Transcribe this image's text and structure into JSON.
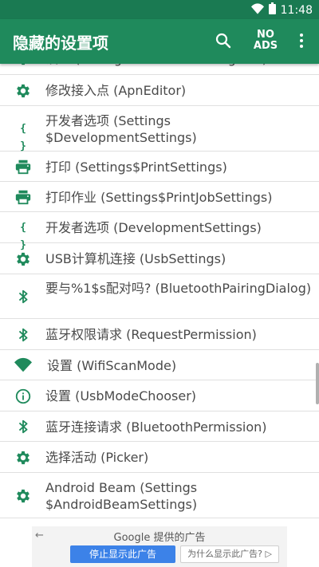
{
  "status_bar": {
    "time": "11:48"
  },
  "app_bar": {
    "title": "隐藏的设置项",
    "no_ads_line1": "NO",
    "no_ads_line2": "ADS"
  },
  "items": [
    {
      "icon": "gear-icon",
      "label": "设置 (StorageWizardMoveProgress)"
    },
    {
      "icon": "gear-icon",
      "label": "修改接入点 (ApnEditor)"
    },
    {
      "icon": "braces-icon",
      "label": "开发者选项 (Settings $DevelopmentSettings)"
    },
    {
      "icon": "printer-icon",
      "label": "打印 (Settings$PrintSettings)"
    },
    {
      "icon": "printer-icon",
      "label": "打印作业 (Settings$PrintJobSettings)"
    },
    {
      "icon": "braces-icon",
      "label": "开发者选项 (DevelopmentSettings)"
    },
    {
      "icon": "gear-icon",
      "label": "USB计算机连接 (UsbSettings)"
    },
    {
      "icon": "bluetooth-icon",
      "label": "要与%1$s配对吗? (BluetoothPairingDialog)"
    },
    {
      "icon": "bluetooth-icon",
      "label": "蓝牙权限请求 (RequestPermission)"
    },
    {
      "icon": "wifi-icon",
      "label": "设置 (WifiScanMode)"
    },
    {
      "icon": "info-icon",
      "label": "设置 (UsbModeChooser)"
    },
    {
      "icon": "bluetooth-icon",
      "label": "蓝牙连接请求 (BluetoothPermission)"
    },
    {
      "icon": "gear-icon",
      "label": "选择活动 (Picker)"
    },
    {
      "icon": "gear-icon",
      "label": "Android Beam (Settings $AndroidBeamSettings)"
    }
  ],
  "ad": {
    "title": "Google 提供的广告",
    "stop_label": "停止显示此广告",
    "why_label": "为什么显示此广告?"
  },
  "colors": {
    "accent": "#1f8a5c",
    "status_bar": "#1a7a52"
  }
}
